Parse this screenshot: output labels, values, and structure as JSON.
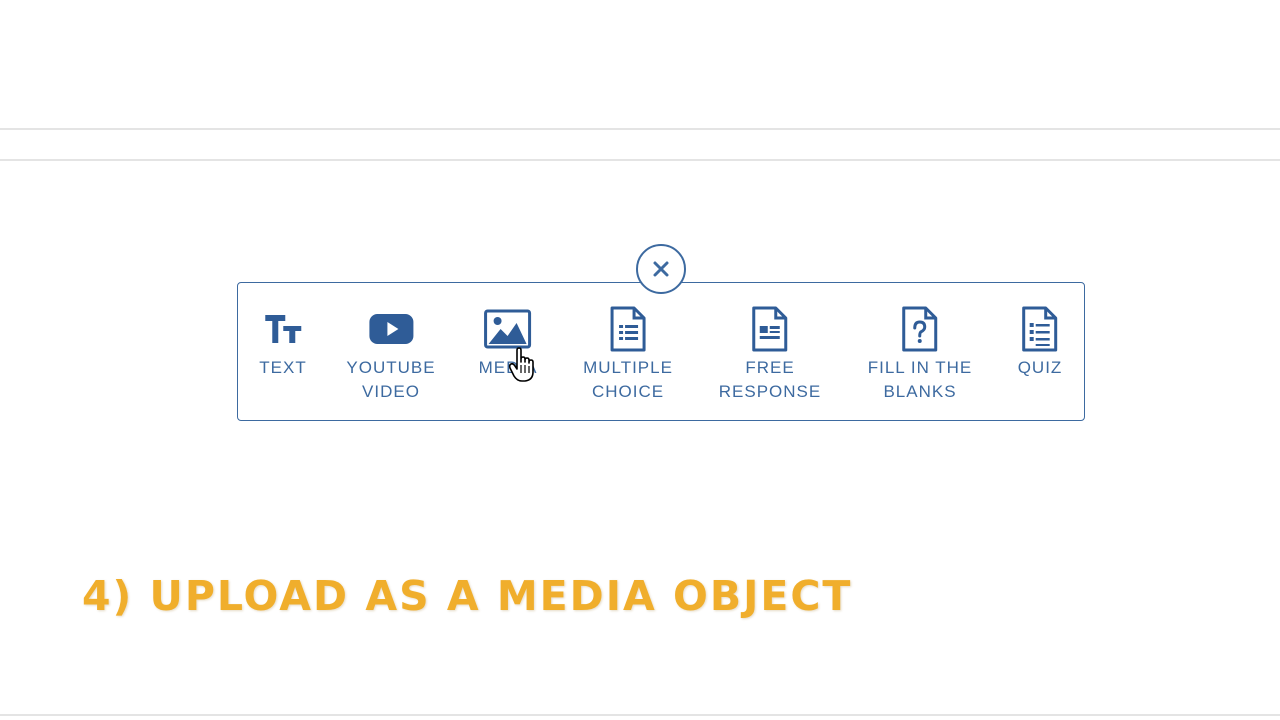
{
  "picker": {
    "options": [
      {
        "id": "text",
        "label": "TEXT",
        "icon": "text-type-icon"
      },
      {
        "id": "youtube",
        "label": "YOUTUBE\nVIDEO",
        "icon": "youtube-play-icon"
      },
      {
        "id": "media",
        "label": "MEDIA",
        "icon": "image-icon"
      },
      {
        "id": "multiple_choice",
        "label": "MULTIPLE\nCHOICE",
        "icon": "document-list-icon"
      },
      {
        "id": "free_response",
        "label": "FREE\nRESPONSE",
        "icon": "document-response-icon"
      },
      {
        "id": "fill_blanks",
        "label": "FILL IN THE\nBLANKS",
        "icon": "document-question-icon"
      },
      {
        "id": "quiz",
        "label": "QUIZ",
        "icon": "document-quiz-icon"
      }
    ],
    "close_icon": "close-icon"
  },
  "caption": "4) UPLOAD AS A MEDIA OBJECT",
  "colors": {
    "accent": "#3d6aa0",
    "caption": "#f0ae2c",
    "divider": "#e4e4e4"
  }
}
